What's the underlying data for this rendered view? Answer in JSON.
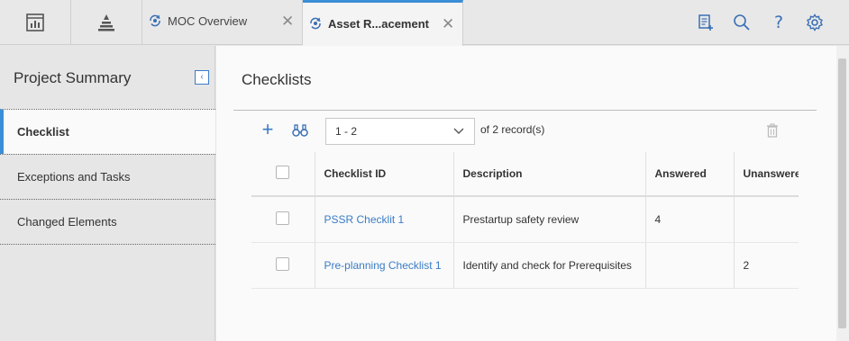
{
  "topbar": {
    "tabs": [
      {
        "label": "MOC Overview",
        "icon": "record-refresh-icon"
      },
      {
        "label": "Asset R...acement",
        "icon": "record-refresh-icon"
      }
    ],
    "left_icons": [
      "dashboard-icon",
      "hierarchy-icon"
    ],
    "right_icons": [
      "new-document-icon",
      "search-icon",
      "help-icon",
      "settings-icon"
    ]
  },
  "sidebar": {
    "title": "Project Summary",
    "items": [
      {
        "label": "Checklist",
        "active": true
      },
      {
        "label": "Exceptions and Tasks",
        "active": false
      },
      {
        "label": "Changed Elements",
        "active": false
      }
    ]
  },
  "main": {
    "title": "Checklists",
    "range": "1 - 2",
    "of_label": "of",
    "record_count": "2",
    "records_label": "record(s)"
  },
  "table": {
    "columns": [
      "Checklist ID",
      "Description",
      "Answered",
      "Unanswered"
    ],
    "rows": [
      {
        "id": "PSSR Checklit 1",
        "description": "Prestartup safety review",
        "answered": "4",
        "unanswered": ""
      },
      {
        "id": "Pre-planning Checklist 1",
        "description": "Identify and check for Prerequisites",
        "answered": "",
        "unanswered": "2"
      }
    ]
  },
  "colors": {
    "accent": "#3a8fd6",
    "link": "#3a7cc6",
    "icon_blue": "#3a6fb4"
  }
}
